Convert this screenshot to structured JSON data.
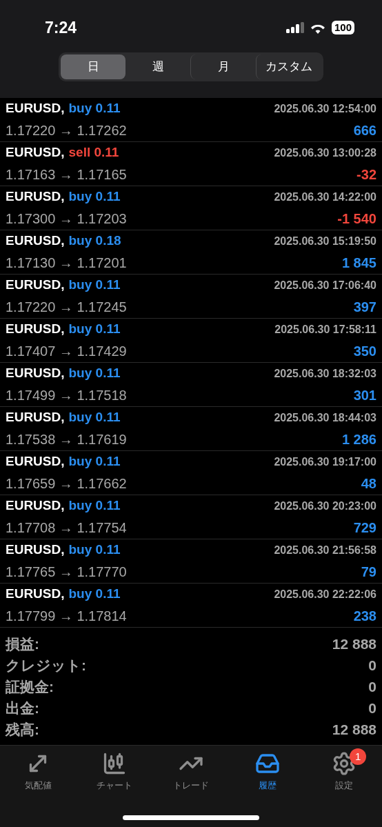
{
  "status_bar": {
    "time": "7:24",
    "battery": "100"
  },
  "period_tabs": [
    {
      "label": "日",
      "selected": true
    },
    {
      "label": "週",
      "selected": false
    },
    {
      "label": "月",
      "selected": false
    },
    {
      "label": "カスタム",
      "selected": false
    }
  ],
  "deals": [
    {
      "symbol": "EURUSD,",
      "kind": "buy",
      "side": "buy 0.11",
      "time": "2025.06.30 12:54:00",
      "prices": "1.17220 → 1.17262",
      "profit": "666",
      "loss": false
    },
    {
      "symbol": "EURUSD,",
      "kind": "sell",
      "side": "sell 0.11",
      "time": "2025.06.30 13:00:28",
      "prices": "1.17163 → 1.17165",
      "profit": "-32",
      "loss": true
    },
    {
      "symbol": "EURUSD,",
      "kind": "buy",
      "side": "buy 0.11",
      "time": "2025.06.30 14:22:00",
      "prices": "1.17300 → 1.17203",
      "profit": "-1 540",
      "loss": true
    },
    {
      "symbol": "EURUSD,",
      "kind": "buy",
      "side": "buy 0.18",
      "time": "2025.06.30 15:19:50",
      "prices": "1.17130 → 1.17201",
      "profit": "1 845",
      "loss": false
    },
    {
      "symbol": "EURUSD,",
      "kind": "buy",
      "side": "buy 0.11",
      "time": "2025.06.30 17:06:40",
      "prices": "1.17220 → 1.17245",
      "profit": "397",
      "loss": false
    },
    {
      "symbol": "EURUSD,",
      "kind": "buy",
      "side": "buy 0.11",
      "time": "2025.06.30 17:58:11",
      "prices": "1.17407 → 1.17429",
      "profit": "350",
      "loss": false
    },
    {
      "symbol": "EURUSD,",
      "kind": "buy",
      "side": "buy 0.11",
      "time": "2025.06.30 18:32:03",
      "prices": "1.17499 → 1.17518",
      "profit": "301",
      "loss": false
    },
    {
      "symbol": "EURUSD,",
      "kind": "buy",
      "side": "buy 0.11",
      "time": "2025.06.30 18:44:03",
      "prices": "1.17538 → 1.17619",
      "profit": "1 286",
      "loss": false
    },
    {
      "symbol": "EURUSD,",
      "kind": "buy",
      "side": "buy 0.11",
      "time": "2025.06.30 19:17:00",
      "prices": "1.17659 → 1.17662",
      "profit": "48",
      "loss": false
    },
    {
      "symbol": "EURUSD,",
      "kind": "buy",
      "side": "buy 0.11",
      "time": "2025.06.30 20:23:00",
      "prices": "1.17708 → 1.17754",
      "profit": "729",
      "loss": false
    },
    {
      "symbol": "EURUSD,",
      "kind": "buy",
      "side": "buy 0.11",
      "time": "2025.06.30 21:56:58",
      "prices": "1.17765 → 1.17770",
      "profit": "79",
      "loss": false
    },
    {
      "symbol": "EURUSD,",
      "kind": "buy",
      "side": "buy 0.11",
      "time": "2025.06.30 22:22:06",
      "prices": "1.17799 → 1.17814",
      "profit": "238",
      "loss": false
    }
  ],
  "summary": [
    {
      "label": "損益:",
      "value": "12 888"
    },
    {
      "label": "クレジット:",
      "value": "0"
    },
    {
      "label": "証拠金:",
      "value": "0"
    },
    {
      "label": "出金:",
      "value": "0"
    },
    {
      "label": "残高:",
      "value": "12 888"
    }
  ],
  "tab_bar": [
    {
      "kind": "quotes",
      "label": "気配値",
      "selected": false
    },
    {
      "kind": "chart",
      "label": "チャート",
      "selected": false
    },
    {
      "kind": "trade",
      "label": "トレード",
      "selected": false
    },
    {
      "kind": "history",
      "label": "履歴",
      "selected": true
    },
    {
      "kind": "settings",
      "label": "設定",
      "selected": false,
      "badge": "1"
    }
  ]
}
